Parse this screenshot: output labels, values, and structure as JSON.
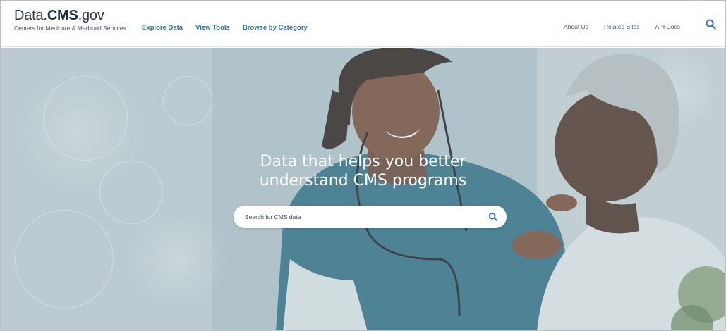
{
  "header": {
    "logo": {
      "prefix": "Data.",
      "brand": "CMS",
      "suffix": ".gov",
      "subtitle": "Centers for Medicare & Medicaid Services"
    },
    "nav_left": [
      {
        "label": "Explore Data"
      },
      {
        "label": "View Tools"
      },
      {
        "label": "Browse by Category"
      }
    ],
    "nav_right": [
      {
        "label": "About Us"
      },
      {
        "label": "Related Sites"
      },
      {
        "label": "API Docs"
      }
    ],
    "search_icon": "search-icon"
  },
  "hero": {
    "title_line1": "Data that helps you better",
    "title_line2": "understand CMS programs",
    "search": {
      "placeholder": "Search for CMS data",
      "value": ""
    }
  },
  "colors": {
    "nav_link": "#2a72b8",
    "brand_text": "#1c2d3f",
    "hero_text": "#ffffff",
    "search_icon": "#2a72b8"
  }
}
